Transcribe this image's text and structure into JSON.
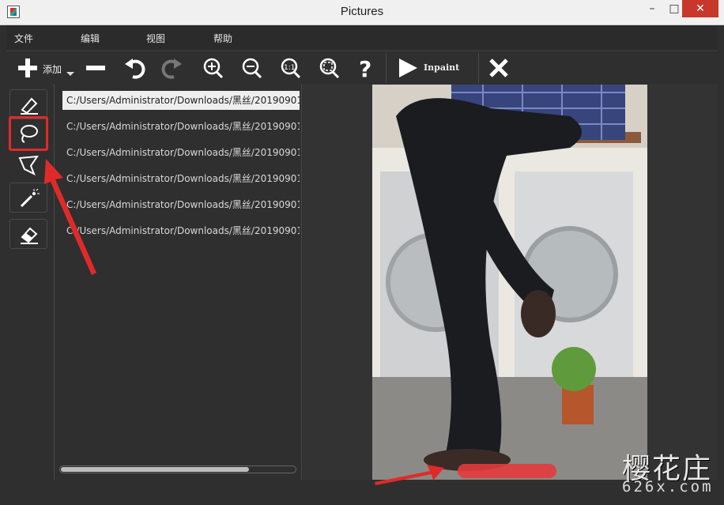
{
  "window": {
    "title": "Pictures",
    "min": "–",
    "max": "□",
    "close": "✕"
  },
  "menu": [
    "文件",
    "编辑",
    "视图",
    "帮助"
  ],
  "toolbar": {
    "add_label": "添加",
    "inpaint_label": "Inpaint"
  },
  "files": [
    "C:/Users/Administrator/Downloads/黑丝/20190901",
    "C:/Users/Administrator/Downloads/黑丝/20190901",
    "C:/Users/Administrator/Downloads/黑丝/20190901",
    "C:/Users/Administrator/Downloads/黑丝/20190901",
    "C:/Users/Administrator/Downloads/黑丝/20190901",
    "C:/Users/Administrator/Downloads/黑丝/20190901"
  ],
  "scroll": {
    "horizontal_thumb_fraction": 0.8
  },
  "watermark": {
    "brand": "樱花庄",
    "site": "626x.com"
  },
  "colors": {
    "highlight": "#e02a2a",
    "bg": "#2f2f2f"
  },
  "icons": [
    "pen-tool-icon",
    "lasso-icon",
    "polygon-lasso-icon",
    "magic-wand-icon",
    "eraser-icon",
    "plus-icon",
    "minus-icon",
    "undo-icon",
    "redo-icon",
    "zoom-in-icon",
    "zoom-out-icon",
    "actual-size-icon",
    "fit-icon",
    "help-icon",
    "play-icon",
    "close-icon"
  ]
}
